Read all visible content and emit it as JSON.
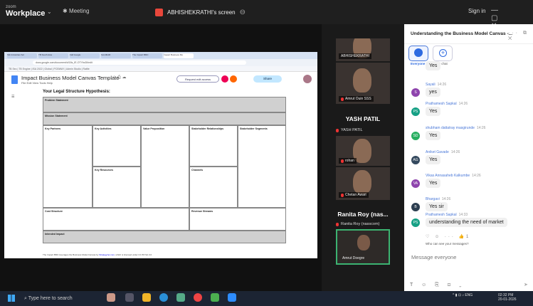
{
  "app": {
    "brand_top": "zoom",
    "brand_main": "Workplace",
    "meeting_label": "Meeting",
    "share_label": "ABHISHEKRATHI's screen",
    "signin_label": "Sign in",
    "window_controls": "— ▢ ✕"
  },
  "browser": {
    "tabs": [
      "Tab Industries Sol",
      "TB South Asia",
      "Fall Google",
      "ScrollbAR",
      "The Impact BMC",
      "Impact Business Mo"
    ],
    "url": "docs.google.com/document/d/18s_fE-OTYbcDt/edit",
    "bookmarks": "TB Sec | TB Engine | ISA 2022 | Global | PCBWAY | Admin Studio | Rattle"
  },
  "doc": {
    "title": "Impact Business Model Canvas Template",
    "title_icons": "☆ ⎙ ☁",
    "menu": "File  Edit  View  Tools  Help",
    "request_edit": "Request edit access",
    "share": "Share",
    "heading": "Your Legal Structure Hypothesis:",
    "cells": {
      "problem": "Problem Statement",
      "mission": "Mission Statement",
      "key_partners": "Key Partners",
      "key_activities": "Key Activities",
      "value_prop": "Value Proposition",
      "stakeholder_rel": "Stakeholder Relationships",
      "stakeholder_seg": "Stakeholder Segments",
      "key_resources": "Key Resources",
      "channels": "Channels",
      "cost": "Cost Structure",
      "revenue": "Revenue Streams",
      "impact": "Intended Impact"
    },
    "footnote_pre": "The Impact BMC leverages the Business Model Canvas by ",
    "footnote_link": "Strategyzer.com",
    "footnote_post": ", which is licensed under CC BY-SA 3.0"
  },
  "videos": {
    "tile1_name": "ABHISHEKRATHI",
    "tile2_name": "Amrut Ouin SSS",
    "big1": "YASH PATIL",
    "sub1": "YASH PATIL",
    "tile3_name": "rohan",
    "tile4_name": "Chetan Awari",
    "big2": "Ranita Roy (nas...",
    "sub2": "Ranita Roy (nasscom)",
    "tile5_name": "Amrut Doegre"
  },
  "chat": {
    "title": "Understanding the Business Model Canvas -...",
    "header_icons": "··· ⧉ ✕",
    "tab_everyone": "Everyone",
    "tab_new_chat": "New chat",
    "messages": [
      {
        "name": "",
        "time": "",
        "text": "Yes",
        "initials": "",
        "color": "#888"
      },
      {
        "name": "Sayali",
        "time": "14:26",
        "text": "yes",
        "initials": "S",
        "color": "#8e44ad"
      },
      {
        "name": "Prathamesh Sapkal",
        "time": "14:26",
        "text": "Yes",
        "initials": "PS",
        "color": "#16a085"
      },
      {
        "name": "shubham dattatray masgirunde",
        "time": "14:26",
        "text": "Yes",
        "initials": "SD",
        "color": "#27ae60"
      },
      {
        "name": "Aniket Gavade",
        "time": "14:26",
        "text": "Yes",
        "initials": "AG",
        "color": "#34495e"
      },
      {
        "name": "Vikas Annasaheb Kalkumbe",
        "time": "14:26",
        "text": "Yes",
        "initials": "VA",
        "color": "#8e44ad"
      },
      {
        "name": "Bhargavi",
        "time": "14:26",
        "text": "Yes sir",
        "initials": "B",
        "color": "#2c3e50"
      },
      {
        "name": "Prathamesh Sapkal",
        "time": "14:33",
        "text": "understanding the need of market",
        "initials": "PS",
        "color": "#16a085"
      }
    ],
    "reactions": "♡ ☺ ··· 👍1",
    "visibility": "Who can see your messages?",
    "input_placeholder": "Message everyone",
    "toolbar": "T ☺ ⎘ ⊡ ⌄"
  },
  "taskbar": {
    "search_placeholder": "Type here to search",
    "tray": "^ ▮ ⊡ ♪ ENG",
    "time": "02:32 PM",
    "date": "20-01-2026"
  }
}
